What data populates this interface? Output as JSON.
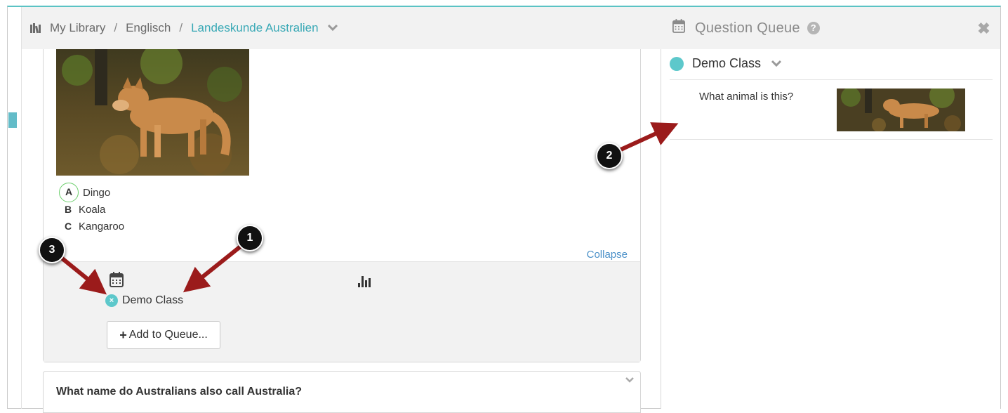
{
  "breadcrumb": {
    "items": [
      "My Library",
      "Englisch"
    ],
    "separator": "/",
    "current": "Landeskunde Australien"
  },
  "question": {
    "answers": [
      {
        "letter": "A",
        "text": "Dingo",
        "correct": true
      },
      {
        "letter": "B",
        "text": "Koala",
        "correct": false
      },
      {
        "letter": "C",
        "text": "Kangaroo",
        "correct": false
      }
    ],
    "collapse_label": "Collapse",
    "queued_class": "Demo Class",
    "remove_symbol": "×",
    "add_button_label": "Add to Queue..."
  },
  "next_question": {
    "text": "What name do Australians also call Australia?"
  },
  "queue_panel": {
    "title": "Question Queue",
    "help_symbol": "?",
    "close_symbol": "✖",
    "class_name": "Demo Class",
    "item_text": "What animal is this?"
  },
  "callouts": [
    "1",
    "2",
    "3"
  ],
  "colors": {
    "accent": "#5dc8cb",
    "link": "#4a90c8",
    "breadcrumb_current": "#3aa9b6",
    "correct_ring": "#6dcf6d",
    "callout_arrow": "#9b1b1b"
  },
  "icons": [
    "library-icon",
    "chevron-down-icon",
    "calendar-icon",
    "bar-chart-icon",
    "remove-icon",
    "plus-icon",
    "help-icon",
    "close-icon"
  ]
}
